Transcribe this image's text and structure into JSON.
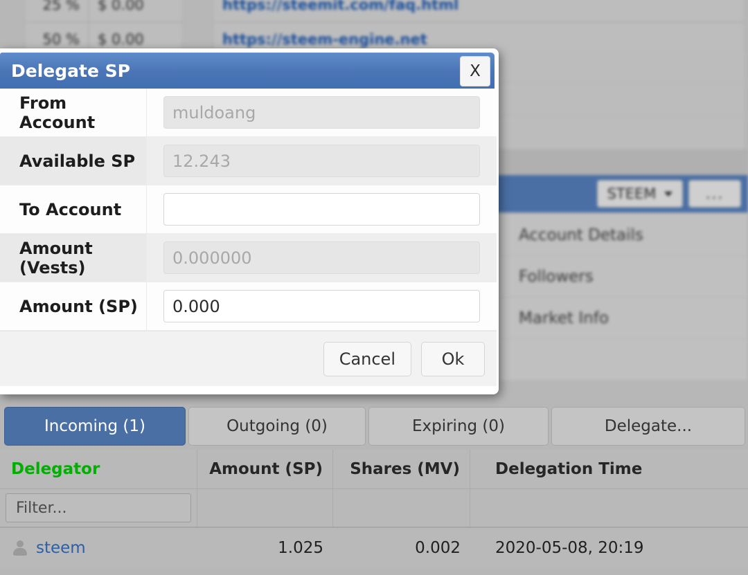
{
  "background": {
    "table_rows": [
      {
        "pct": "25 %",
        "amount": "$ 0.00",
        "url": "https://steemit.com/faq.html"
      },
      {
        "pct": "50 %",
        "amount": "$ 0.00",
        "url": "https://steem-engine.net"
      }
    ],
    "toolbar": {
      "currency_label": "STEEM",
      "more_label": "..."
    },
    "menu_items": [
      {
        "label": "Account Details"
      },
      {
        "label": "Followers"
      },
      {
        "label": "Market Info"
      },
      {
        "label": ""
      }
    ]
  },
  "dialog": {
    "title": "Delegate SP",
    "close_label": "X",
    "fields": [
      {
        "label": "From Account",
        "value": "",
        "placeholder": "muldoang",
        "readonly": true
      },
      {
        "label": "Available SP",
        "value": "",
        "placeholder": "12.243",
        "readonly": true
      },
      {
        "label": "To Account",
        "value": "",
        "placeholder": "",
        "readonly": false
      },
      {
        "label": "Amount (Vests)",
        "value": "",
        "placeholder": "0.000000",
        "readonly": true
      },
      {
        "label": "Amount (SP)",
        "value": "0.000",
        "placeholder": "",
        "readonly": false
      }
    ],
    "cancel_label": "Cancel",
    "ok_label": "Ok"
  },
  "tabs": [
    {
      "label": "Incoming (1)",
      "active": true
    },
    {
      "label": "Outgoing (0)",
      "active": false
    },
    {
      "label": "Expiring (0)",
      "active": false
    },
    {
      "label": "Delegate...",
      "active": false
    }
  ],
  "table": {
    "columns": [
      "Delegator",
      "Amount (SP)",
      "Shares (MV)",
      "Delegation Time"
    ],
    "filter_placeholder": "Filter...",
    "rows": [
      {
        "delegator": "steem",
        "amount_sp": "1.025",
        "shares_mv": "0.002",
        "delegation_time": "2020-05-08, 20:19",
        "icon": "person-icon"
      }
    ]
  },
  "colors": {
    "accent_blue": "#4a6fa5",
    "title_blue": "#4a74b5",
    "link_blue": "#2b5fa8",
    "header_green": "#00b000",
    "panel_gray": "#b9b9b9"
  }
}
